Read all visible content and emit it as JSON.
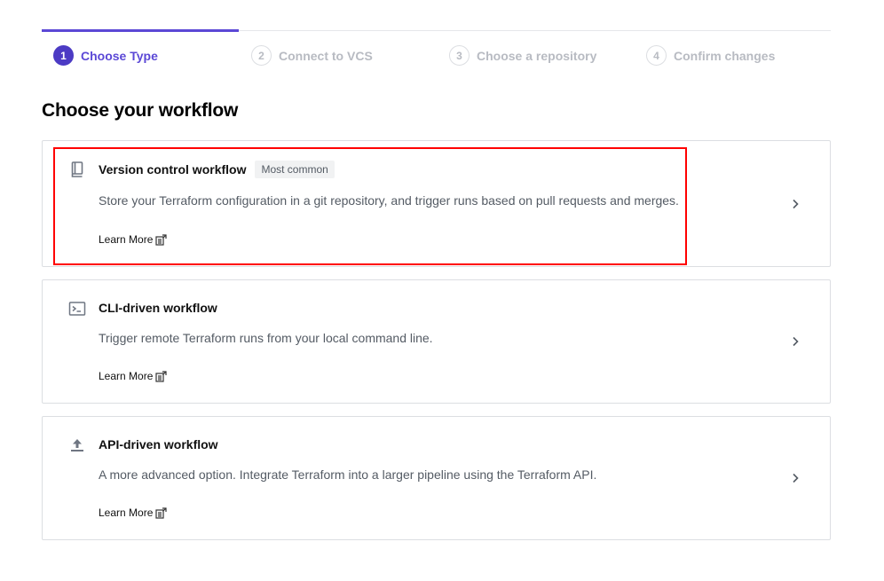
{
  "stepper": {
    "steps": [
      {
        "num": "1",
        "label": "Choose Type"
      },
      {
        "num": "2",
        "label": "Connect to VCS"
      },
      {
        "num": "3",
        "label": "Choose a repository"
      },
      {
        "num": "4",
        "label": "Confirm changes"
      }
    ],
    "active_step": 1
  },
  "page_title": "Choose your workflow",
  "cards": [
    {
      "icon": "book-icon",
      "title": "Version control workflow",
      "badge": "Most common",
      "description": "Store your Terraform configuration in a git repository, and trigger runs based on pull requests and merges.",
      "learn_more": "Learn More"
    },
    {
      "icon": "terminal-icon",
      "title": "CLI-driven workflow",
      "description": "Trigger remote Terraform runs from your local command line.",
      "learn_more": "Learn More"
    },
    {
      "icon": "upload-icon",
      "title": "API-driven workflow",
      "description": "A more advanced option. Integrate Terraform into a larger pipeline using the Terraform API.",
      "learn_more": "Learn More"
    }
  ],
  "colors": {
    "accent": "#5b48d6",
    "highlight": "#ff0000"
  }
}
